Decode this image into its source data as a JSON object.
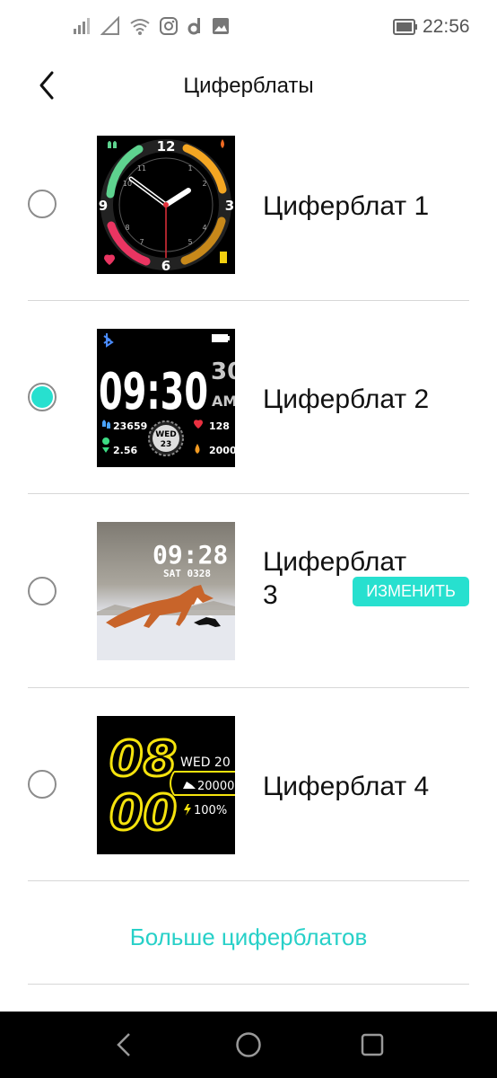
{
  "status_bar": {
    "time": "22:56"
  },
  "header": {
    "title": "Циферблаты"
  },
  "faces": [
    {
      "label": "Циферблат 1",
      "selected": false,
      "thumb": {
        "n12": "12",
        "n3": "3",
        "n6": "6",
        "n9": "9",
        "n11": "11",
        "n1": "1",
        "n2": "2",
        "n4": "4",
        "n5": "5",
        "n7": "7",
        "n8": "8",
        "n10": "10"
      }
    },
    {
      "label": "Циферблат 2",
      "selected": true,
      "thumb": {
        "time": "09:30",
        "sec": "30",
        "ampm": "AM",
        "steps": "23659",
        "heart": "128",
        "dist": "2.56",
        "cal": "2000",
        "day": "WED",
        "date": "23"
      }
    },
    {
      "label": "Циферблат 3",
      "selected": false,
      "thumb": {
        "time": "09:28",
        "date": "SAT 0328"
      }
    },
    {
      "label": "Циферблат 4",
      "selected": false,
      "thumb": {
        "hour": "08",
        "minute": "00",
        "day": "WED 20",
        "steps": "20000",
        "battery": "100%"
      }
    }
  ],
  "edit_button": {
    "label": "ИЗМЕНИТЬ"
  },
  "more_link": {
    "label": "Больше циферблатов"
  },
  "colors": {
    "accent": "#27e0cf",
    "link": "#27d0c8"
  },
  "icons": [
    "signal-icon",
    "no-signal-icon",
    "wifi-icon",
    "instagram-icon",
    "d-app-icon",
    "image-icon",
    "battery-icon"
  ]
}
